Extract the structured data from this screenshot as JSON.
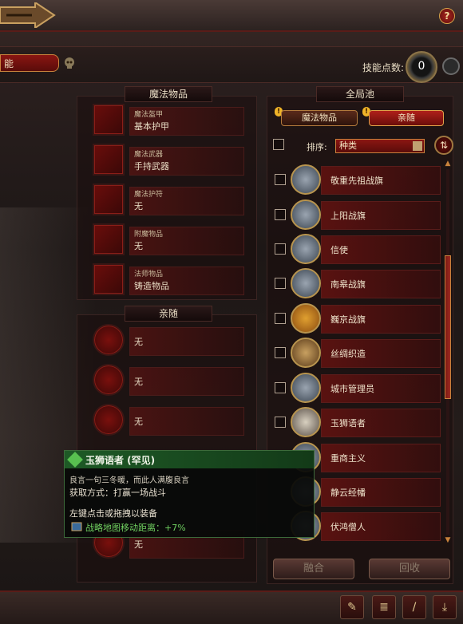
{
  "header": {
    "name_field": "能",
    "help_glyph": "?",
    "skill_points_label": "技能点数:",
    "skill_points_value": "0"
  },
  "magic_items": {
    "title": "魔法物品",
    "slots": [
      {
        "category": "魔法盔甲",
        "value": "基本护甲"
      },
      {
        "category": "魔法武器",
        "value": "手持武器"
      },
      {
        "category": "魔法护符",
        "value": "无"
      },
      {
        "category": "附魔物品",
        "value": "无"
      },
      {
        "category": "法师物品",
        "value": "铸造物品"
      }
    ]
  },
  "followers": {
    "title": "亲随",
    "slots": [
      {
        "value": "无"
      },
      {
        "value": "无"
      },
      {
        "value": "无"
      },
      {
        "value": "无"
      }
    ]
  },
  "global_pool": {
    "title": "全局池",
    "tabs": [
      {
        "label": "魔法物品",
        "active": false
      },
      {
        "label": "亲随",
        "active": true
      }
    ],
    "sort_label": "排序:",
    "sort_value": "种类",
    "items": [
      {
        "label": "敬重先祖战旗",
        "icon": "banner-icon"
      },
      {
        "label": "上阳战旗",
        "icon": "banner-icon"
      },
      {
        "label": "信使",
        "icon": "soldier-icon"
      },
      {
        "label": "南皋战旗",
        "icon": "banner-icon"
      },
      {
        "label": "巍京战旗",
        "icon": "banner-icon"
      },
      {
        "label": "丝绸织造",
        "icon": "soldier-icon"
      },
      {
        "label": "城市管理员",
        "icon": "soldier-icon"
      },
      {
        "label": "玉狮语者",
        "icon": "soldier-icon"
      },
      {
        "label": "重商主义",
        "icon": "soldier-icon"
      },
      {
        "label": "静云经幡",
        "icon": "banner-icon"
      },
      {
        "label": "伏鸿僧人",
        "icon": "monk-icon"
      }
    ],
    "merge_button": "融合",
    "recycle_button": "回收"
  },
  "tooltip": {
    "title": "玉狮语者 (罕见)",
    "description": "良言一句三冬暖，而此人满腹良言",
    "obtain": "获取方式：打赢一场战斗",
    "hint": "左键点击或拖拽以装备",
    "effect": "战略地图移动距离：+7%"
  },
  "colors": {
    "accent_red": "#8a1612",
    "gold_border": "#c9833c",
    "tooltip_green": "#1e5a26"
  }
}
